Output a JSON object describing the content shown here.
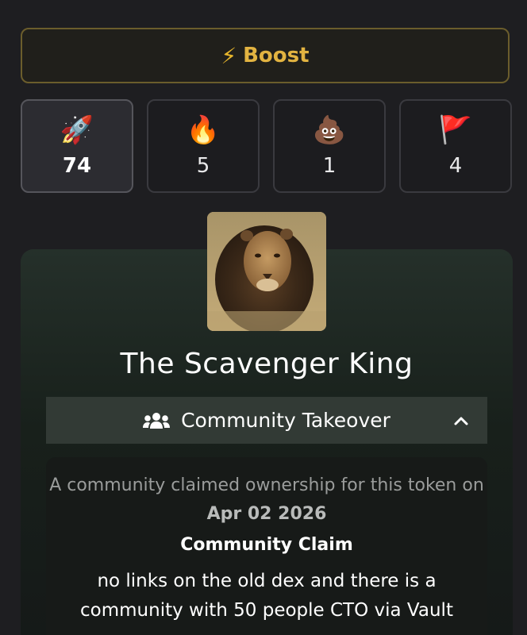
{
  "boost": {
    "icon": "lightning-bolt-icon",
    "glyph": "⚡",
    "label": "Boost",
    "accent": "#e2b341"
  },
  "reactions": [
    {
      "icon": "rocket-icon",
      "glyph": "🚀",
      "count": "74",
      "active": true
    },
    {
      "icon": "fire-icon",
      "glyph": "🔥",
      "count": "5",
      "active": false
    },
    {
      "icon": "poop-icon",
      "glyph": "💩",
      "count": "1",
      "active": false
    },
    {
      "icon": "red-flag-icon",
      "glyph": "🚩",
      "count": "4",
      "active": false
    }
  ],
  "token": {
    "name": "The Scavenger King"
  },
  "cto": {
    "icon": "users-icon",
    "label": "Community Takeover",
    "toggle_icon": "chevron-up-icon"
  },
  "claim": {
    "desc_prefix": "A community claimed ownership for this token on",
    "date": "Apr 02 2026",
    "title": "Community Claim",
    "text": "no links on the old dex and there is a community with 50 people CTO via Vault"
  }
}
